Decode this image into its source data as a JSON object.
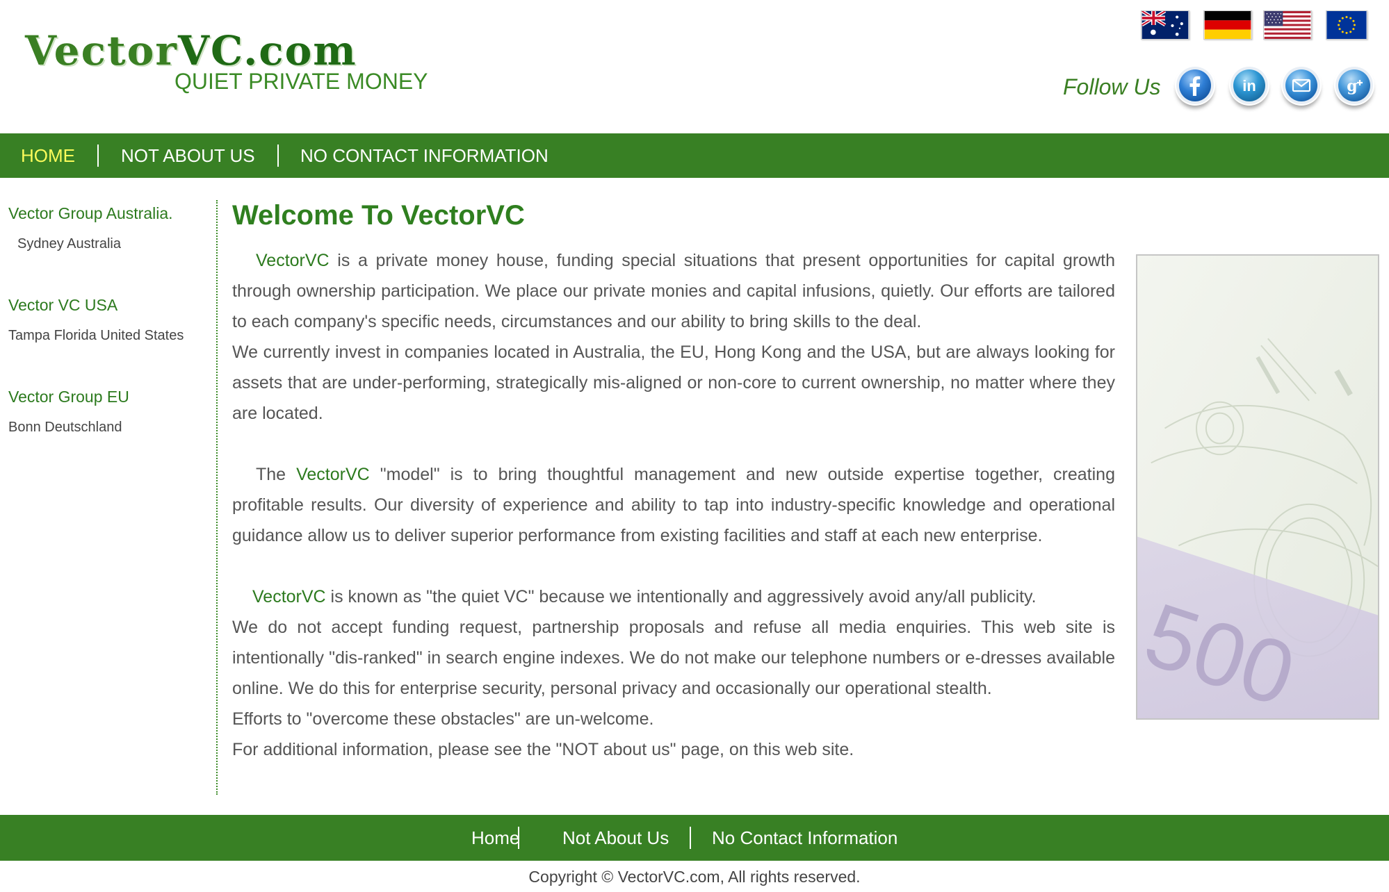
{
  "logo": {
    "name_part1": "Vector",
    "name_part2": "VC.com",
    "tagline": "QUIET PRIVATE MONEY"
  },
  "flags": [
    {
      "icon": "australia-flag-icon"
    },
    {
      "icon": "germany-flag-icon"
    },
    {
      "icon": "usa-flag-icon"
    },
    {
      "icon": "eu-flag-icon"
    }
  ],
  "follow": {
    "label": "Follow Us",
    "icons": [
      "facebook-icon",
      "linkedin-icon",
      "email-icon",
      "google-plus-icon"
    ]
  },
  "nav": {
    "items": [
      {
        "label": "HOME",
        "active": true
      },
      {
        "label": "NOT ABOUT US",
        "active": false
      },
      {
        "label": "NO CONTACT INFORMATION",
        "active": false
      }
    ],
    "active_color": "#fbfb5a"
  },
  "sidebar": {
    "locations": [
      {
        "title": "Vector Group Australia.",
        "city": "Sydney Australia"
      },
      {
        "title": "Vector VC USA",
        "city": "Tampa Florida United States"
      },
      {
        "title": "Vector Group EU",
        "city": "Bonn Deutschland"
      }
    ]
  },
  "main": {
    "heading": "Welcome To VectorVC",
    "brand": "VectorVC",
    "p1_rest": " is a private money house, funding special situations that present opportunities for capital growth through ownership participation. We place our private monies and capital infusions, quietly. Our efforts are tailored to each company's specific needs, circumstances and our ability to bring skills to the deal.",
    "p2": "We currently invest in companies located in Australia, the EU, Hong Kong and the USA, but are always looking for assets that are under-performing, strategically mis-aligned or non-core to current ownership, no matter where they are located.",
    "p3_pre": "The ",
    "p3_rest": " \"model\" is to bring thoughtful management and new outside expertise together, creating profitable results. Our diversity of experience and ability to tap into industry-specific knowledge and operational guidance allow us to deliver superior performance from existing facilities and staff at each new enterprise.",
    "p4_rest": " is known as \"the quiet VC\" because we intentionally and aggressively avoid any/all publicity.",
    "p5": "We do not accept funding request, partnership proposals and refuse all media enquiries. This web site is intentionally \"dis-ranked\" in search engine indexes. We do not make our telephone numbers or e-dresses available online. We do this for enterprise security, personal privacy and occasionally our operational stealth.",
    "p6": "Efforts to \"overcome these obstacles\" are un-welcome.",
    "p7": "For additional information, please see the \"NOT about us\" page, on this web site.",
    "side_image": "money-banknotes-image"
  },
  "footer": {
    "links": [
      "Home",
      "Not About Us",
      "No Contact Information"
    ],
    "copyright": "Copyright © VectorVC.com, All rights reserved."
  },
  "colors": {
    "brand_green": "#388024",
    "text_green": "#2c7a1e",
    "body_text": "#555555"
  }
}
